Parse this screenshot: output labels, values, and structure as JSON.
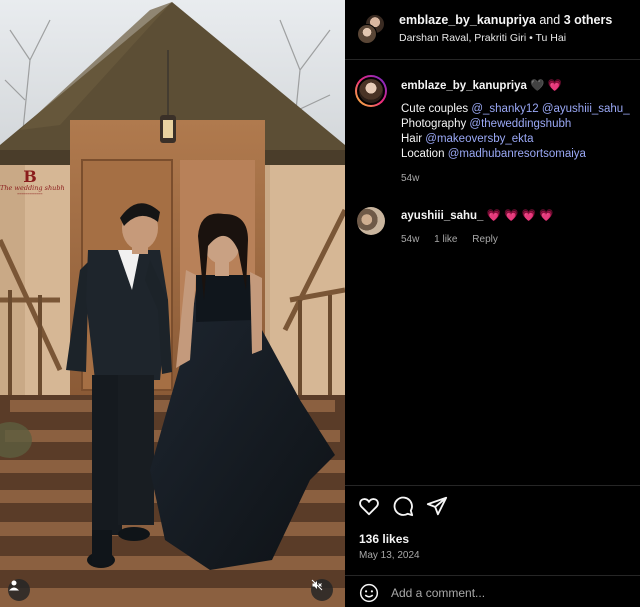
{
  "post": {
    "watermark": {
      "name": "The wedding shubh"
    },
    "header": {
      "username": "emblaze_by_kanupriya",
      "connector": " and ",
      "others": "3 others",
      "subtitle": "Darshan Raval, Prakriti Giri • Tu Hai"
    },
    "caption": {
      "username": "emblaze_by_kanupriya",
      "emojis": "🖤 💗",
      "lines": [
        {
          "label": "Cute couples ",
          "links": [
            "@_shanky12",
            "@ayushiii_sahu_"
          ]
        },
        {
          "label": "Photography ",
          "links": [
            "@theweddingshubh"
          ]
        },
        {
          "label": "Hair ",
          "links": [
            "@makeoversby_ekta"
          ]
        },
        {
          "label": "Location ",
          "links": [
            "@madhubanresortsomaiya"
          ]
        }
      ],
      "time": "54w"
    },
    "comment": {
      "username": "ayushiii_sahu_",
      "text": "💗 💗 💗 💗",
      "time": "54w",
      "likes": "1 like",
      "reply": "Reply"
    },
    "likes": "136 likes",
    "date": "May 13, 2024",
    "add_comment_placeholder": "Add a comment..."
  },
  "icons": {
    "like": "heart-icon",
    "comment": "comment-bubble-icon",
    "share": "paper-plane-icon",
    "emoji": "smiley-icon",
    "user_tag": "user-icon",
    "mute": "speaker-muted-icon"
  }
}
